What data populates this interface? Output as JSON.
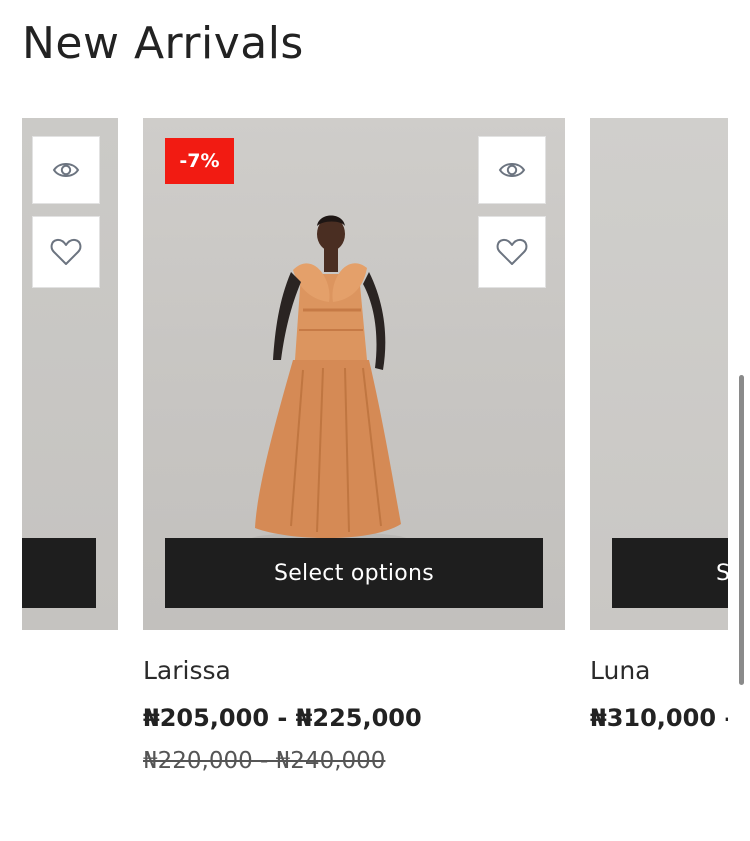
{
  "section": {
    "title": "New Arrivals"
  },
  "products": [
    {
      "name": "",
      "price": "",
      "old_price": "",
      "button_label": ""
    },
    {
      "name": "Larissa",
      "badge": "-7%",
      "price": "₦205,000 - ₦225,000",
      "old_price": "₦220,000 - ₦240,000",
      "button_label": "Select options"
    },
    {
      "name": "Luna",
      "price": "₦310,000 -",
      "button_label": "S"
    }
  ],
  "colors": {
    "badge_bg": "#f21b12",
    "button_bg": "#1e1e1e",
    "image_bg": "#c8c6c3"
  },
  "icons": [
    "eye-icon",
    "heart-icon"
  ]
}
